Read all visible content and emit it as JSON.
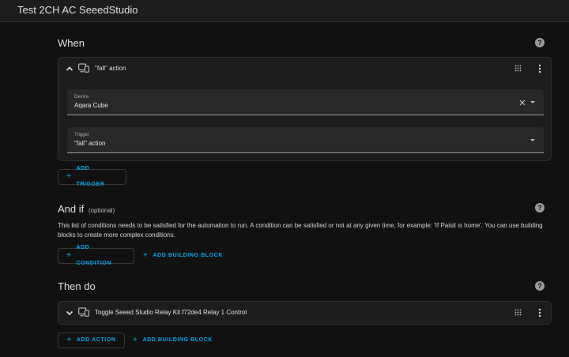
{
  "app": {
    "title": "Test 2CH AC SeeedStudio"
  },
  "when": {
    "title": "When",
    "help": "?",
    "trigger_card": {
      "label": "\"fall\" action",
      "device_field": {
        "label": "Device",
        "value": "Aqara Cube"
      },
      "trigger_field": {
        "label": "Trigger",
        "value": "\"fall\" action"
      }
    },
    "add_trigger": "ADD TRIGGER"
  },
  "and_if": {
    "title": "And if",
    "optional": "(optional)",
    "help": "?",
    "description": "This list of conditions needs to be satisfied for the automation to run. A condition can be satisfied or not at any given time, for example: 'If Paisit is home'. You can use building blocks to create more complex conditions.",
    "add_condition": "ADD CONDITION",
    "add_building_block": "ADD BUILDING BLOCK"
  },
  "then_do": {
    "title": "Then do",
    "help": "?",
    "action_card": {
      "label": "Toggle Seeed Studio Relay Kit f72de4 Relay 1 Control"
    },
    "add_action": "ADD ACTION",
    "add_building_block": "ADD BUILDING BLOCK"
  },
  "icons": {
    "plus": "+"
  },
  "colors": {
    "accent": "#03a9f4",
    "background": "#111111",
    "card": "#1c1c1c"
  }
}
